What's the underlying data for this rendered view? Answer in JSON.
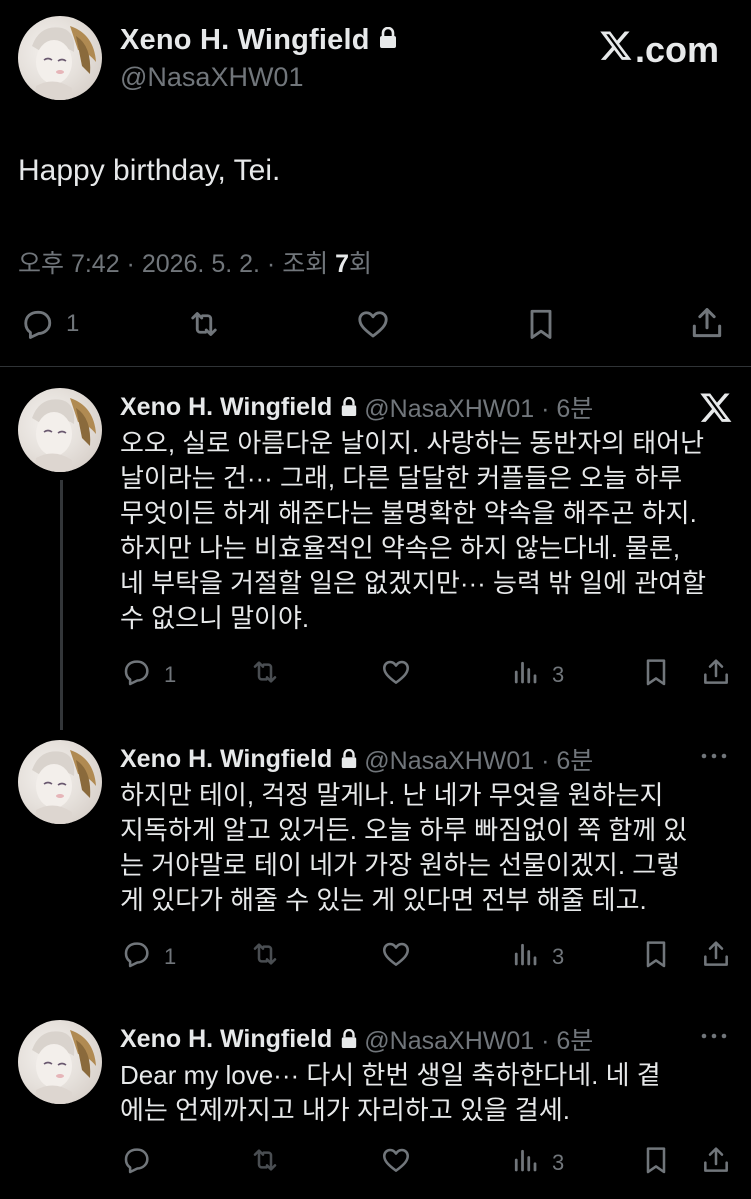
{
  "main": {
    "name": "Xeno H. Wingfield",
    "handle": "@NasaXHW01",
    "brand": ".com",
    "text": "Happy birthday, Tei.",
    "meta_prefix": "오후 7:42 · 2026. 5. 2. · 조회 ",
    "views": "7",
    "meta_suffix": "회",
    "reply_count": "1"
  },
  "replies": [
    {
      "name": "Xeno H. Wingfield",
      "handle": "@NasaXHW01 · 6분",
      "lines": [
        "오오, 실로 아름다운 날이지. 사랑하는 동반자의 태어난",
        "날이라는 건··· 그래, 다른 달달한 커플들은 오늘 하루",
        "무엇이든 하게 해준다는 불명확한 약속을 해주곤 하지.",
        "하지만 나는 비효율적인 약속은 하지 않는다네. 물론,",
        "네 부탁을 거절할 일은 없겠지만··· 능력 밖 일에 관여할",
        "수 없으니 말이야."
      ],
      "reply_count": "1",
      "views": "3"
    },
    {
      "name": "Xeno H. Wingfield",
      "handle": "@NasaXHW01 · 6분",
      "lines": [
        "하지만 테이, 걱정 말게나. 난 네가 무엇을 원하는지",
        "지독하게 알고 있거든. 오늘 하루 빠짐없이 쭉 함께 있",
        "는 거야말로 테이 네가 가장 원하는 선물이겠지. 그렇",
        "게 있다가 해줄 수 있는 게 있다면 전부 해줄 테고."
      ],
      "reply_count": "1",
      "views": "3"
    },
    {
      "name": "Xeno H. Wingfield",
      "handle": "@NasaXHW01 · 6분",
      "lines": [
        "Dear my love··· 다시 한번 생일 축하한다네. 네 곁",
        "에는 언제까지고 내가 자리하고 있을 걸세."
      ],
      "reply_count": "",
      "views": "3"
    }
  ],
  "icons": {
    "lock": "lock-icon",
    "x_logo": "x-logo-icon",
    "reply": "reply-icon",
    "retweet": "retweet-icon",
    "like": "like-icon",
    "bookmark": "bookmark-icon",
    "share": "share-icon",
    "views": "views-icon",
    "more": "more-icon"
  },
  "colors": {
    "background": "#000000",
    "text": "#e7e9ea",
    "muted": "#71767b",
    "divider": "#2f3336"
  }
}
